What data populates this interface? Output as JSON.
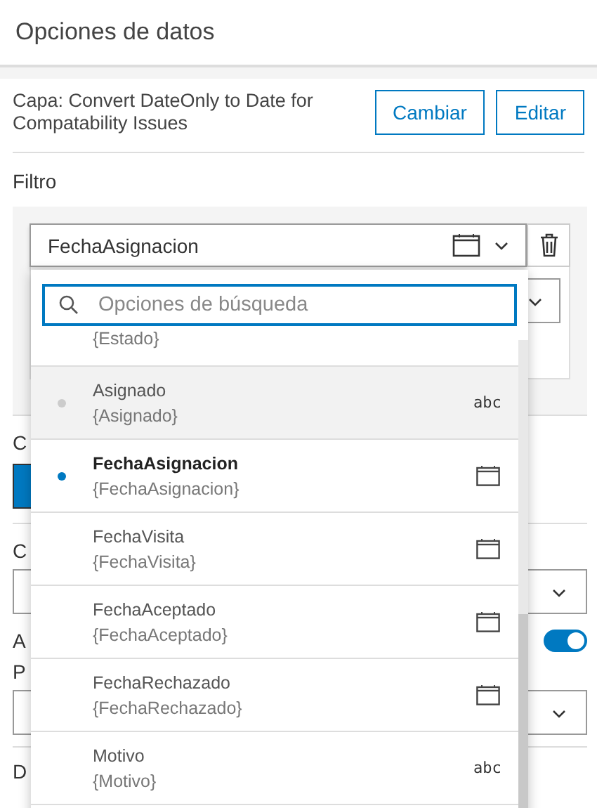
{
  "title": "Opciones de datos",
  "layer": {
    "text": "Capa: Convert DateOnly to Date for Compatability Issues",
    "buttons": [
      "Cambiar",
      "Editar"
    ]
  },
  "filter": {
    "label": "Filtro",
    "field_value": "FechaAsignacion"
  },
  "hidden_labels": [
    "C",
    "C",
    "A",
    "P",
    "D"
  ],
  "toggle": {
    "on": true
  },
  "dropdown": {
    "placeholder": "Opciones de búsqueda",
    "items": [
      {
        "field": "{Estado}",
        "partial": true,
        "selected": false,
        "hovered": false
      },
      {
        "name": "Asignado",
        "field": "{Asignado}",
        "kind": "text",
        "type_label": "abc",
        "selected": false,
        "hovered": true
      },
      {
        "name": "FechaAsignacion",
        "field": "{FechaAsignacion}",
        "kind": "date",
        "selected": true,
        "hovered": false
      },
      {
        "name": "FechaVisita",
        "field": "{FechaVisita}",
        "kind": "date",
        "selected": false,
        "hovered": false
      },
      {
        "name": "FechaAceptado",
        "field": "{FechaAceptado}",
        "kind": "date",
        "selected": false,
        "hovered": false
      },
      {
        "name": "FechaRechazado",
        "field": "{FechaRechazado}",
        "kind": "date",
        "selected": false,
        "hovered": false
      },
      {
        "name": "Motivo",
        "field": "{Motivo}",
        "kind": "text",
        "type_label": "abc",
        "selected": false,
        "hovered": false
      }
    ]
  }
}
